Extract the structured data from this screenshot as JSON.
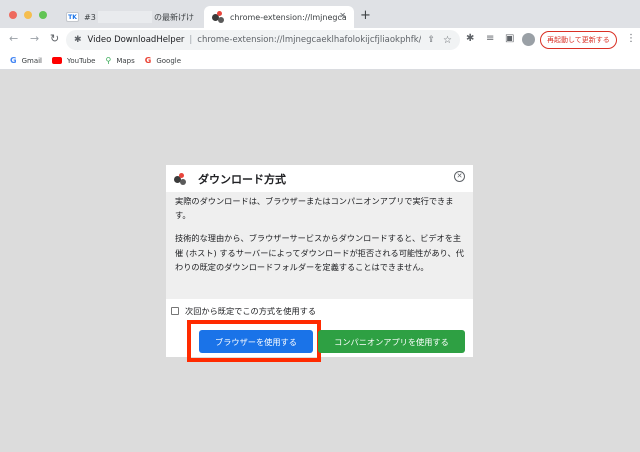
{
  "browser": {
    "tabs": [
      {
        "favicon": "TK",
        "title_prefix": "#3",
        "title_suffix": "の最新げけ"
      },
      {
        "title": "chrome-extension://lmjnegcae",
        "active": true
      }
    ],
    "new_tab_label": "+",
    "omnibox": {
      "host": "Video DownloadHelper",
      "separator": "|",
      "url": "chrome-extension://lmjnegcaeklhafolokijcfjliaokphfk/..."
    },
    "relaunch_label": "再起動して更新する",
    "bookmarks": [
      {
        "label": "Gmail"
      },
      {
        "label": "YouTube"
      },
      {
        "label": "Maps"
      },
      {
        "label": "Google"
      }
    ]
  },
  "dialog": {
    "title": "ダウンロード方式",
    "paragraph1": "実際のダウンロードは、ブラウザーまたはコンパニオンアプリで実行できます。",
    "paragraph2": "技術的な理由から、ブラウザーサービスからダウンロードすると、ビデオを主催 (ホスト) するサーバーによってダウンロードが拒否される可能性があり、代わりの既定のダウンロードフォルダーを定義することはできません。",
    "remember_label": "次回から既定でこの方式を使用する",
    "use_browser_label": "ブラウザーを使用する",
    "use_companion_label": "コンパニオンアプリを使用する"
  },
  "colors": {
    "browser_button": "#1a73e8",
    "companion_button": "#2ea043",
    "highlight": "#ff2a00",
    "relaunch": "#d93025"
  }
}
